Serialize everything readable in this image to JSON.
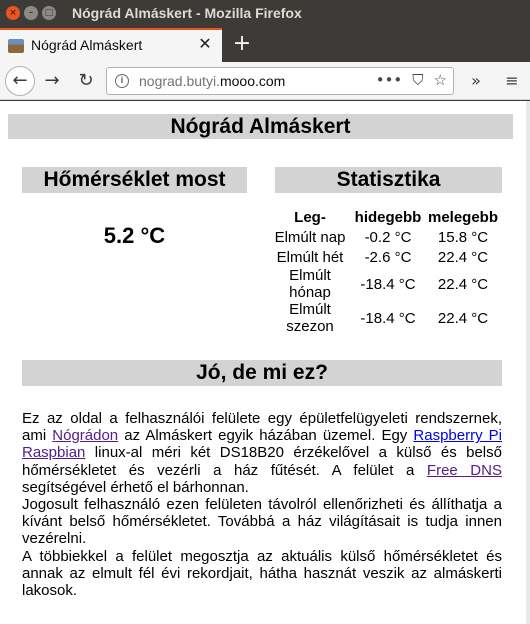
{
  "window": {
    "title": "Nógrád Almáskert - Mozilla Firefox"
  },
  "tab": {
    "title": "Nógrád Almáskert"
  },
  "navbar": {
    "url_prefix": "nograd.butyi.",
    "url_domain": "mooo.com"
  },
  "page": {
    "title": "Nógrád Almáskert",
    "now_heading": "Hőmérséklet most",
    "now_value": "5.2 °C",
    "stats_heading": "Statisztika",
    "stats_headers": [
      "Leg-",
      "hidegebb",
      "melegebb"
    ],
    "stats_rows": [
      {
        "label": "Elmúlt nap",
        "cold": "-0.2 °C",
        "warm": "15.8 °C"
      },
      {
        "label": "Elmúlt hét",
        "cold": "-2.6 °C",
        "warm": "22.4 °C"
      },
      {
        "label": "Elmúlt hónap",
        "cold": "-18.4 °C",
        "warm": "22.4 °C"
      },
      {
        "label": "Elmúlt szezon",
        "cold": "-18.4 °C",
        "warm": "22.4 °C"
      }
    ],
    "about_heading": "Jó, de mi ez?",
    "about": {
      "t1": "Ez az oldal a felhasználói felülete egy épületfelügyeleti rendszernek, ami ",
      "link_nograd": "Nógrádon",
      "t2": " az Almáskert egyik házában üzemel. Egy ",
      "link_rpi": "Raspberry Pi",
      "t3": " ",
      "link_raspbian": "Raspbian",
      "t4": " linux-al méri két DS18B20 érzékelővel a külső és belső hőmérsékletet és vezérli a ház fűtését. A felület a ",
      "link_dns": "Free DNS",
      "t5": " segítségével érhető el bárhonnan.",
      "p2": "Jogosult felhasználó ezen felületen távolról ellenőrizheti és állíthatja a kívánt belső hőmérsékletet. Továbbá a ház világításait is tudja innen vezérelni.",
      "p3": "A többiekkel a felület megosztja az aktuális külső hőmérsékletet és annak az elmult fél évi rekordjait, hátha hasznát veszik az almáskerti lakosok."
    }
  }
}
